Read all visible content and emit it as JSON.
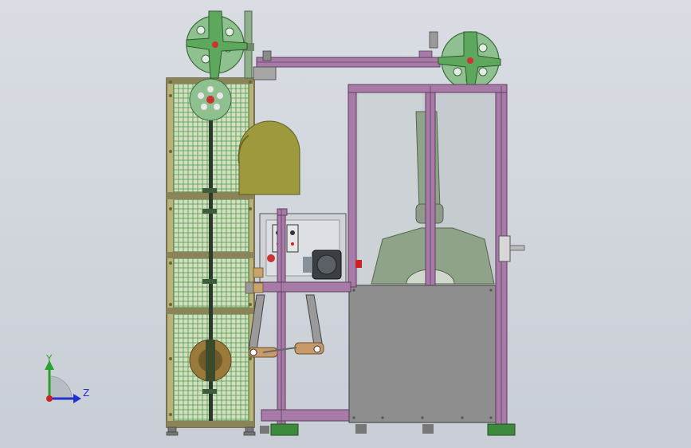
{
  "colors": {
    "background": "#ccd1d8",
    "frame_profile": "#a87aa8",
    "frame_dark": "#5c3f5c",
    "guard_frame": "#b9b27a",
    "guard_mesh": "#3fa33f",
    "reel_green": "#8fc08f",
    "reel_dark": "#3d6b3d",
    "cover_olive": "#9c9a3c",
    "panel_grey": "#8e8e8e",
    "glass": "#c6cbcf",
    "machine_green": "#8fa389",
    "axis_y": "#2ea02e",
    "axis_z": "#2233cc",
    "origin_red": "#cc2222"
  },
  "triad": {
    "y_label": "Y",
    "z_label": "Z"
  }
}
